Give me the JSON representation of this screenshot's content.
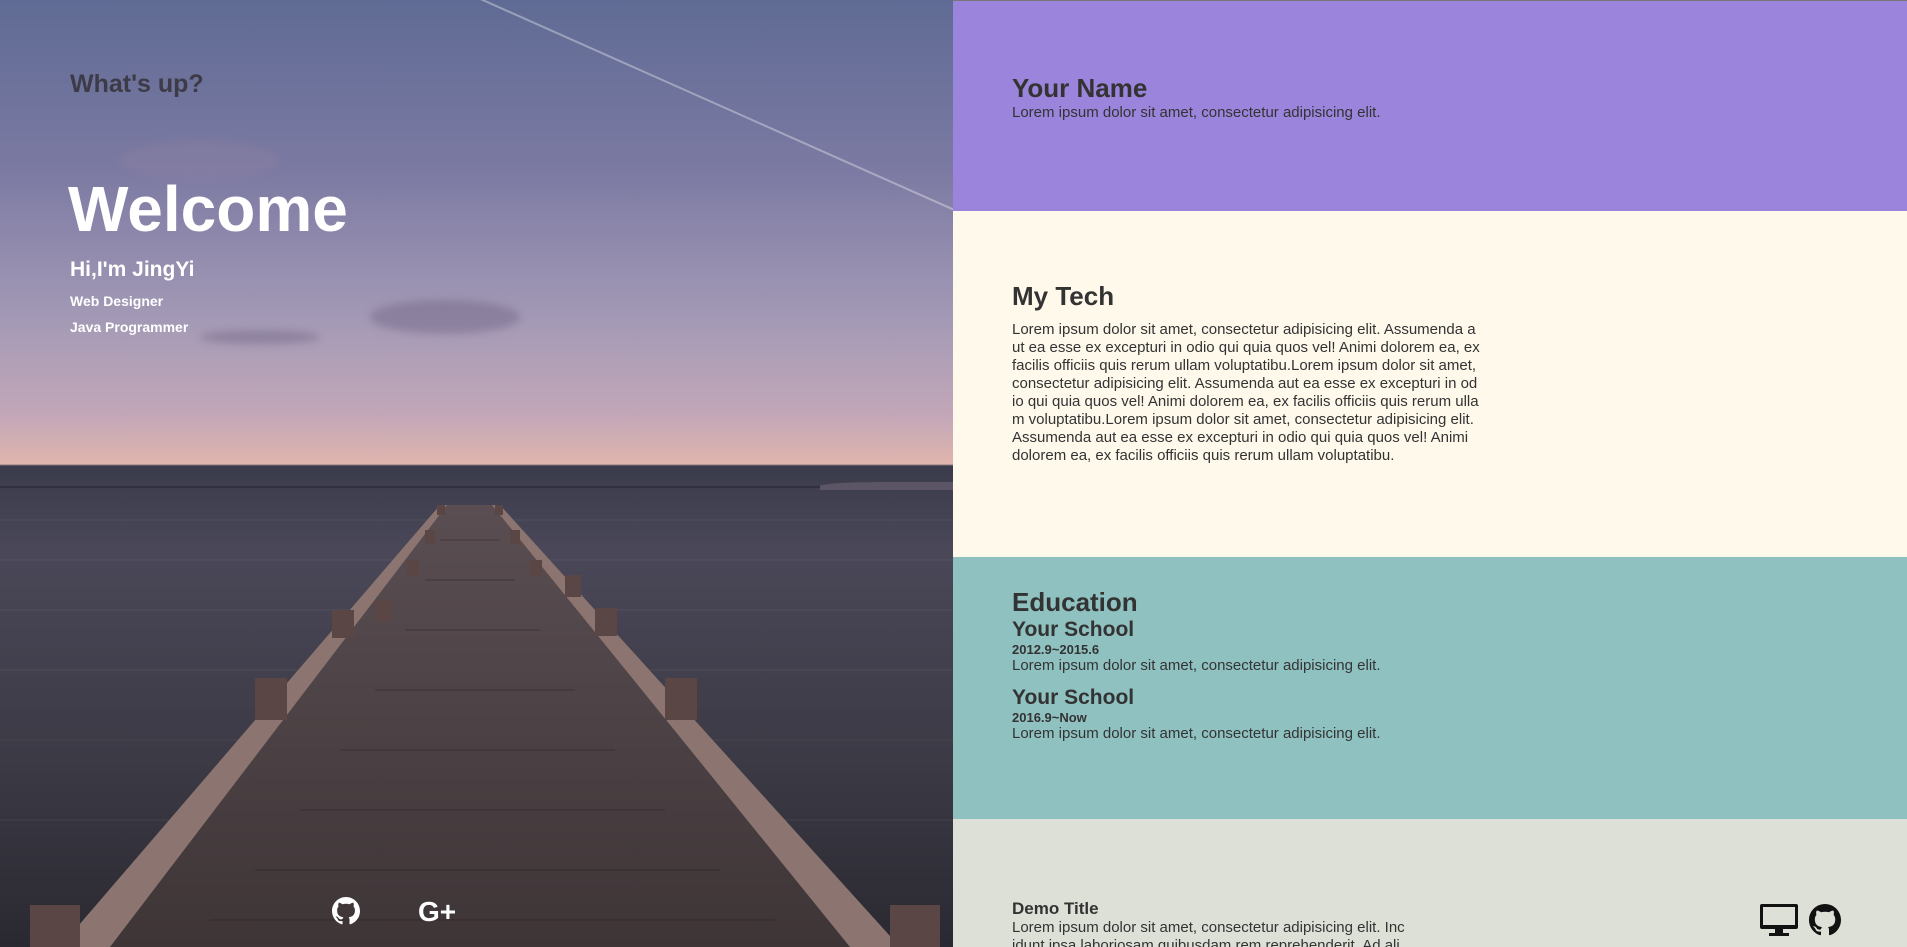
{
  "hero": {
    "greeting": "What's up?",
    "welcome": "Welcome",
    "intro": "Hi,I'm JingYi",
    "roles": [
      "Web Designer",
      "Java Programmer"
    ],
    "social": [
      {
        "icon": "github-icon"
      },
      {
        "icon": "google-plus-icon"
      }
    ]
  },
  "profile": {
    "name": "Your Name",
    "tagline": "Lorem ipsum dolor sit amet, consectetur adipisicing elit."
  },
  "tech": {
    "title": "My Tech",
    "lines": [
      "Lorem ipsum dolor sit amet, consectetur adipisicing elit. Assumenda a",
      "ut ea esse ex excepturi in odio qui quia quos vel! Animi dolorem ea, ex",
      "facilis officiis quis rerum ullam voluptatibu.Lorem ipsum dolor sit amet,",
      "consectetur adipisicing elit. Assumenda aut ea esse ex excepturi in od",
      "io qui quia quos vel! Animi dolorem ea, ex facilis officiis quis rerum ulla",
      "m voluptatibu.Lorem ipsum dolor sit amet, consectetur adipisicing elit.",
      "Assumenda aut ea esse ex excepturi in odio qui quia quos vel! Animi",
      "dolorem ea, ex facilis officiis quis rerum ullam voluptatibu."
    ]
  },
  "education": {
    "title": "Education",
    "schools": [
      {
        "name": "Your School",
        "period": "2012.9~2015.6",
        "desc": "Lorem ipsum dolor sit amet, consectetur adipisicing elit."
      },
      {
        "name": "Your School",
        "period": "2016.9~Now",
        "desc": "Lorem ipsum dolor sit amet, consectetur adipisicing elit."
      }
    ]
  },
  "demo": {
    "title": "Demo Title",
    "lines": [
      "Lorem ipsum dolor sit amet, consectetur adipisicing elit. Inc",
      "idunt ipsa laboriosam quibusdam rem reprehenderit. Ad ali"
    ],
    "icons": [
      "monitor-icon",
      "github-icon"
    ]
  },
  "colors": {
    "name_bg": "#9b84dc",
    "tech_bg": "#fff9ec",
    "education_bg": "#8fc1c1",
    "demo_bg": "#dde0d7"
  }
}
